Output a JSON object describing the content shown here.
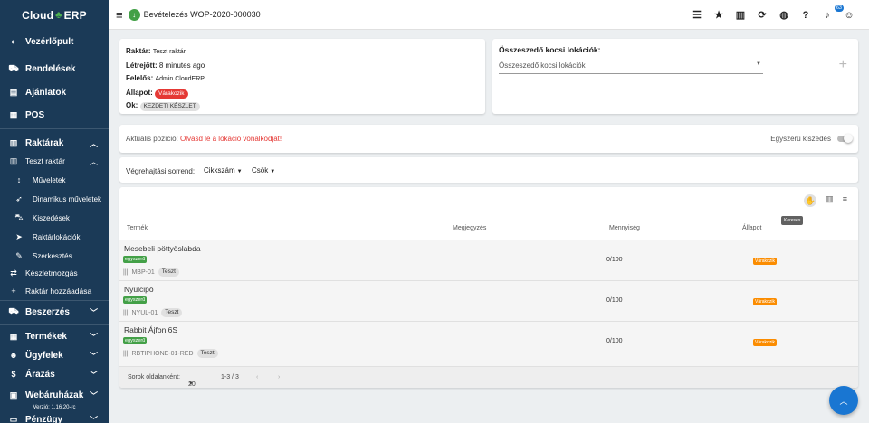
{
  "brand": {
    "name_left": "Cloud",
    "name_right": "ERP"
  },
  "sidebar": {
    "items": [
      {
        "label": "Vezérlőpult",
        "icon": "palette-icon"
      },
      {
        "label": "Rendelések",
        "icon": "cart-icon"
      },
      {
        "label": "Ajánlatok",
        "icon": "document-icon"
      },
      {
        "label": "POS",
        "icon": "pos-icon"
      },
      {
        "label": "Raktárak",
        "icon": "warehouse-icon"
      },
      {
        "label": "Teszt raktár",
        "icon": "warehouse-icon"
      },
      {
        "label": "Műveletek",
        "icon": "swap-vertical-icon"
      },
      {
        "label": "Dinamikus műveletek",
        "icon": "rocket-icon"
      },
      {
        "label": "Kiszedések",
        "icon": "dolly-icon"
      },
      {
        "label": "Raktárlokációk",
        "icon": "location-icon"
      },
      {
        "label": "Szerkesztés",
        "icon": "wrench-icon"
      },
      {
        "label": "Készletmozgás",
        "icon": "arrows-icon"
      },
      {
        "label": "Raktár hozzáadása",
        "icon": "plus-icon"
      },
      {
        "label": "Beszerzés",
        "icon": "truck-icon"
      },
      {
        "label": "Termékek",
        "icon": "products-icon"
      },
      {
        "label": "Ügyfelek",
        "icon": "users-icon"
      },
      {
        "label": "Árazás",
        "icon": "dollar-icon"
      },
      {
        "label": "Webáruházak",
        "icon": "store-icon"
      },
      {
        "label": "Pénzügy",
        "icon": "money-icon"
      }
    ],
    "version": "Verzió: 1.16.20-rc"
  },
  "topbar": {
    "title": "Bevételezés WOP-2020-000030",
    "notification_count": "63"
  },
  "info": {
    "warehouse_label": "Raktár:",
    "warehouse_value": "Teszt raktár",
    "created_label": "Létrejött:",
    "created_value": "8 minutes ago",
    "owner_label": "Felelős:",
    "owner_value": "Admin CloudERP",
    "status_label": "Állapot:",
    "status_value": "Várakozik",
    "reason_label": "Ok:",
    "reason_value": "KEZDETI KÉSZLET"
  },
  "locations": {
    "title": "Összeszedő kocsi lokációk:",
    "placeholder": "Összeszedő kocsi lokációk"
  },
  "position": {
    "label": "Aktuális pozíció:",
    "warning": "Olvasd le a lokáció vonalkódját!",
    "simple_receive": "Egyszerű kiszedés"
  },
  "order": {
    "label": "Végrehajtási sorrend:",
    "sort_field": "Cikkszám",
    "sort_dir": "Csök"
  },
  "table": {
    "tooltip": "Keresés",
    "headers": {
      "product": "Termék",
      "note": "Megjegyzés",
      "quantity": "Mennyiség",
      "status": "Állapot"
    },
    "rows": [
      {
        "name": "Mesebeli pöttyöslabda",
        "tag": "egyszerű",
        "sku": "MBP-01",
        "chip": "Teszt",
        "qty": "0/100",
        "status": "Várakozik"
      },
      {
        "name": "Nyúlcipő",
        "tag": "egyszerű",
        "sku": "NYUL-01",
        "chip": "Teszt",
        "qty": "0/100",
        "status": "Várakozik"
      },
      {
        "name": "Rabbit Ájfon 6S",
        "tag": "egyszerű",
        "sku": "RBTIPHONE-01-RED",
        "chip": "Teszt",
        "qty": "0/100",
        "status": "Várakozik"
      }
    ],
    "footer": {
      "rows_label": "Sorok oldalanként:",
      "rows_value": "20",
      "range": "1-3 / 3"
    }
  },
  "colors": {
    "sidebar": "#1b3a57",
    "accent": "#1976d2",
    "danger": "#e53935",
    "success": "#43a047",
    "warning": "#fb8c00"
  }
}
